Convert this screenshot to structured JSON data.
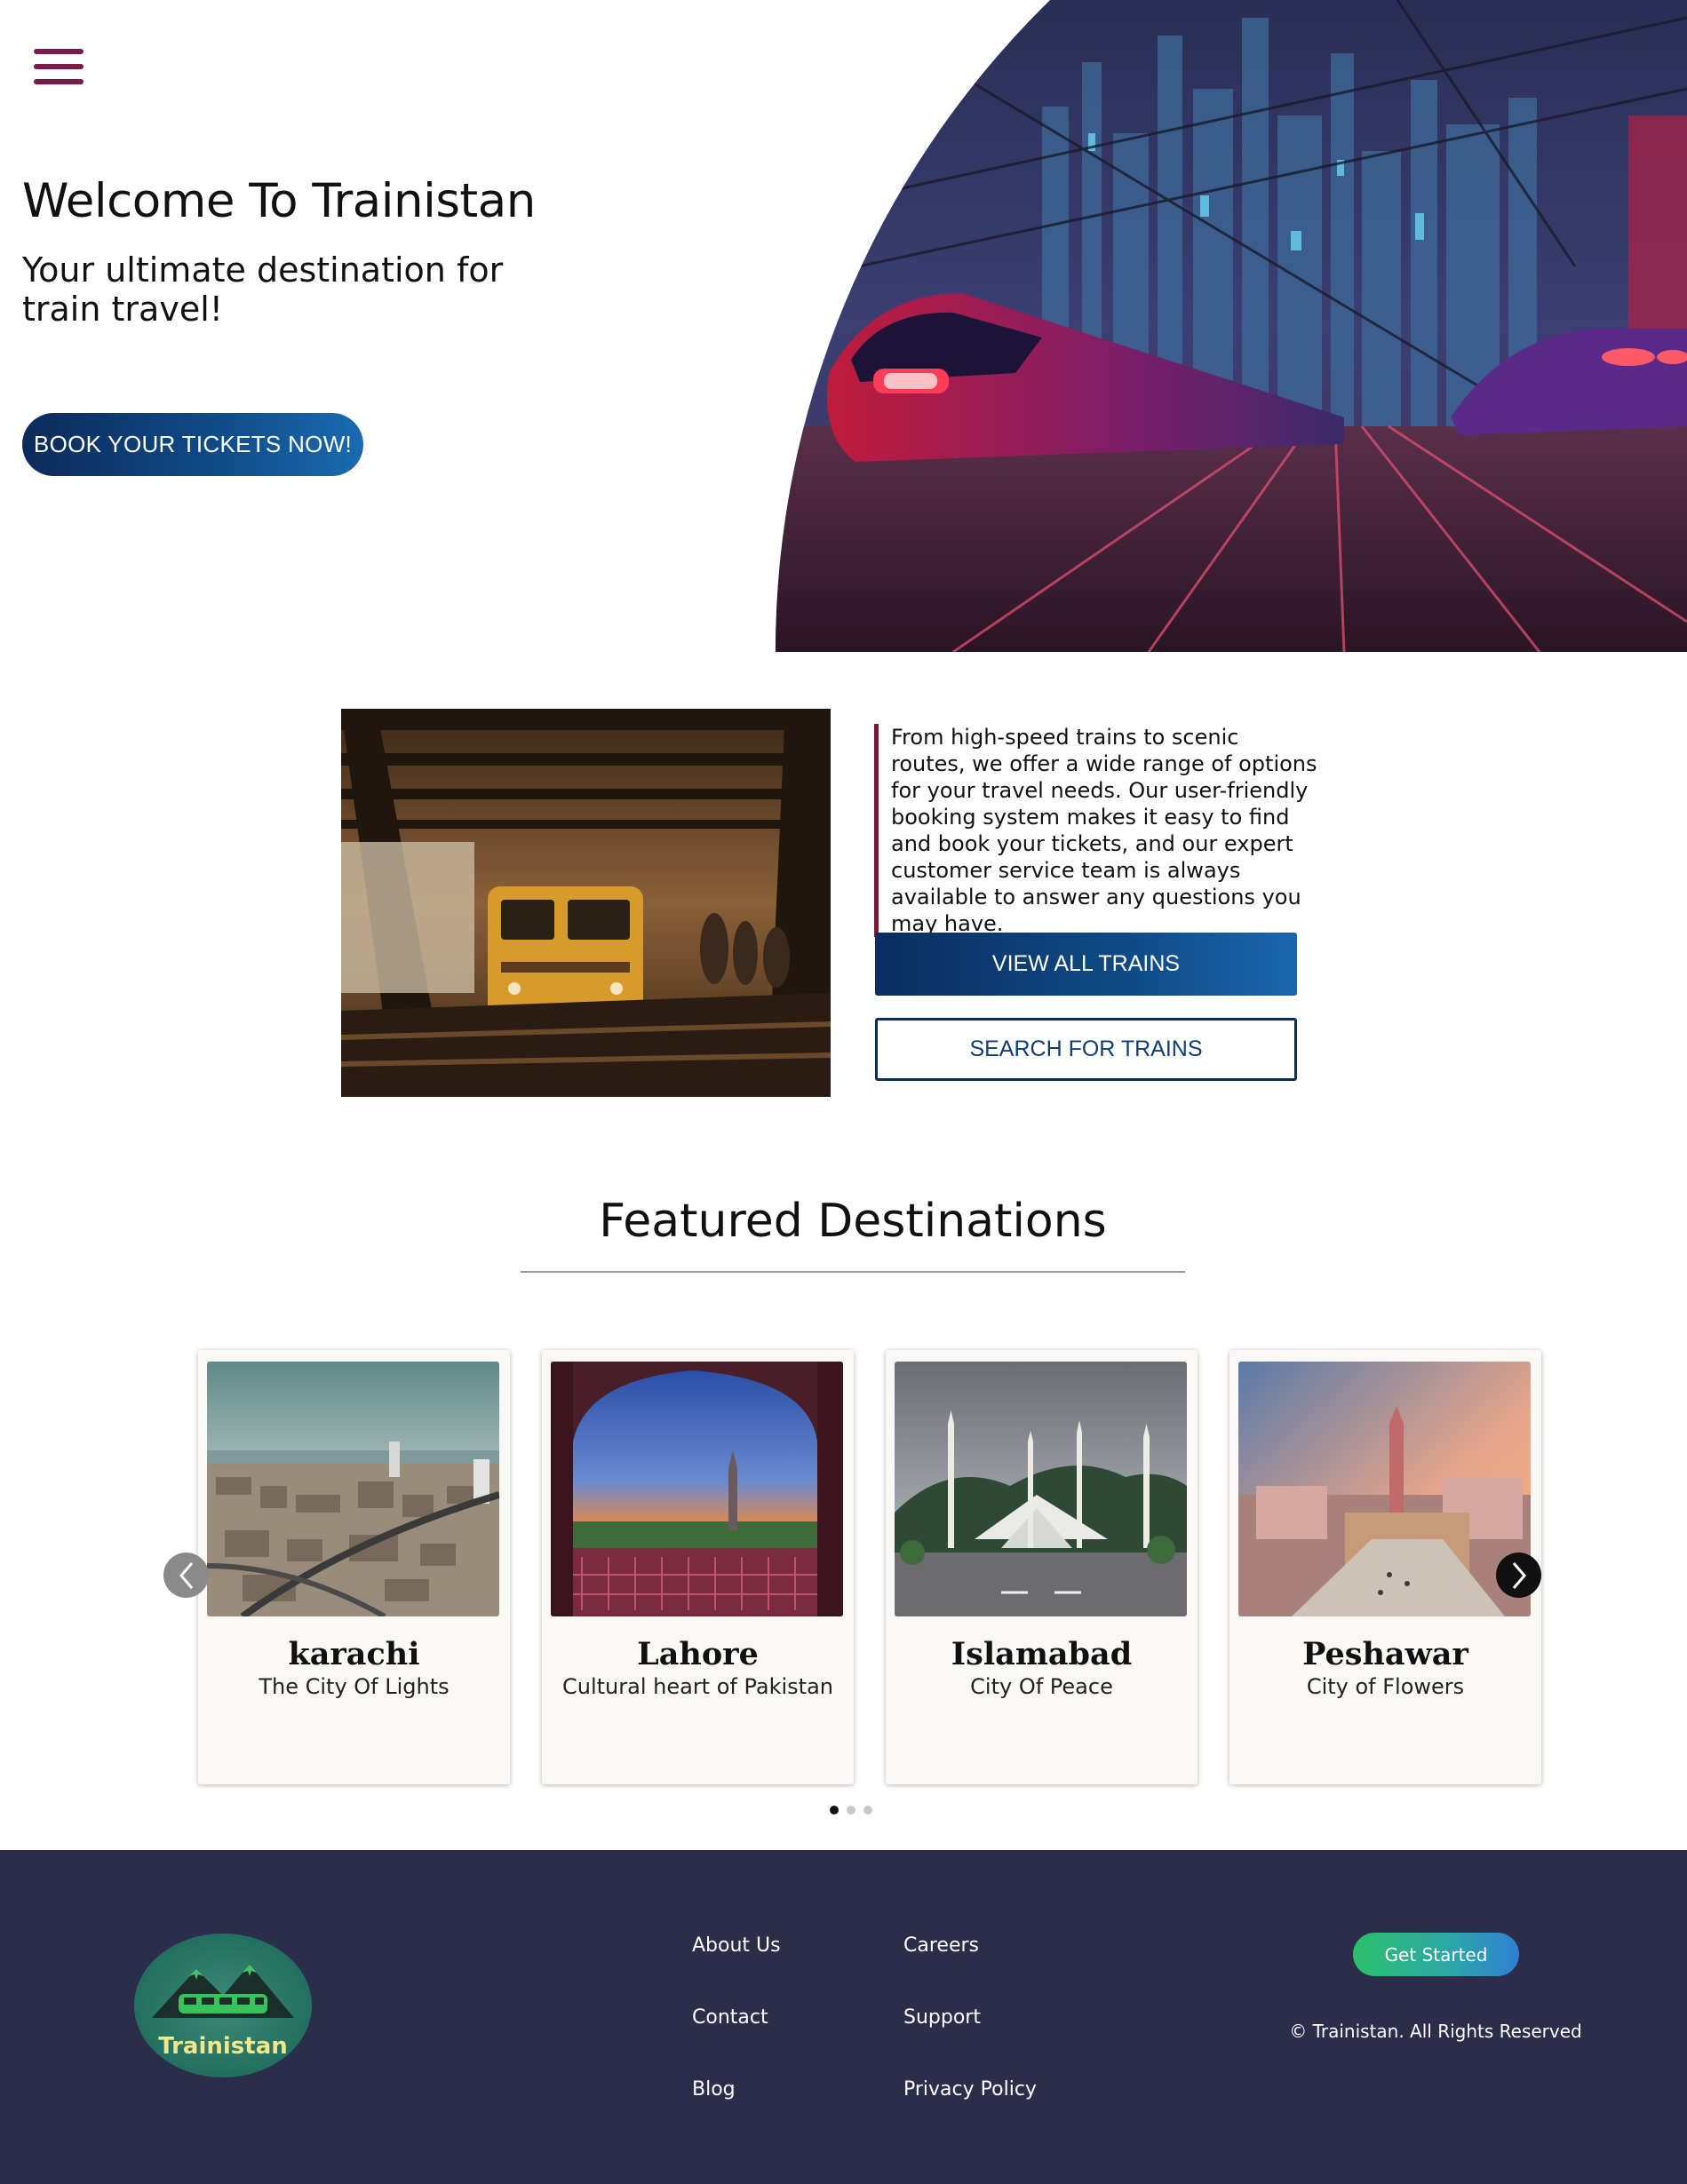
{
  "nav": {
    "menu_icon": "hamburger-menu-icon"
  },
  "hero": {
    "title": "Welcome To Trainistan",
    "subtitle": "Your ultimate destination for train travel!",
    "cta_label": "BOOK YOUR TICKETS NOW!"
  },
  "about": {
    "description": "From high-speed trains to scenic routes, we offer a wide range of options for your travel needs. Our user-friendly booking system makes it easy to find and book your tickets, and our expert customer service team is always available to answer any questions you may have.",
    "view_all_label": "VIEW ALL TRAINS",
    "search_label": "SEARCH FOR TRAINS"
  },
  "featured": {
    "title": "Featured Destinations",
    "cards": [
      {
        "name": "karachi",
        "tagline": "The City Of Lights"
      },
      {
        "name": "Lahore",
        "tagline": "Cultural heart of Pakistan"
      },
      {
        "name": "Islamabad",
        "tagline": "City Of Peace"
      },
      {
        "name": "Peshawar",
        "tagline": "City of Flowers"
      }
    ],
    "pagination": {
      "pages": 3,
      "active": 1
    }
  },
  "footer": {
    "logo_text": "Trainistan",
    "links": [
      "About Us",
      "Careers",
      "Contact",
      "Support",
      "Blog",
      "Privacy Policy"
    ],
    "get_started_label": "Get Started",
    "copyright": "© Trainistan. All Rights Reserved"
  },
  "colors": {
    "accent": "#7a1a4a",
    "primary_button": "#0f4a86",
    "footer_bg": "#2b2d4b",
    "get_started_gradient_start": "#2bc06a",
    "get_started_gradient_end": "#2e7fd4"
  }
}
